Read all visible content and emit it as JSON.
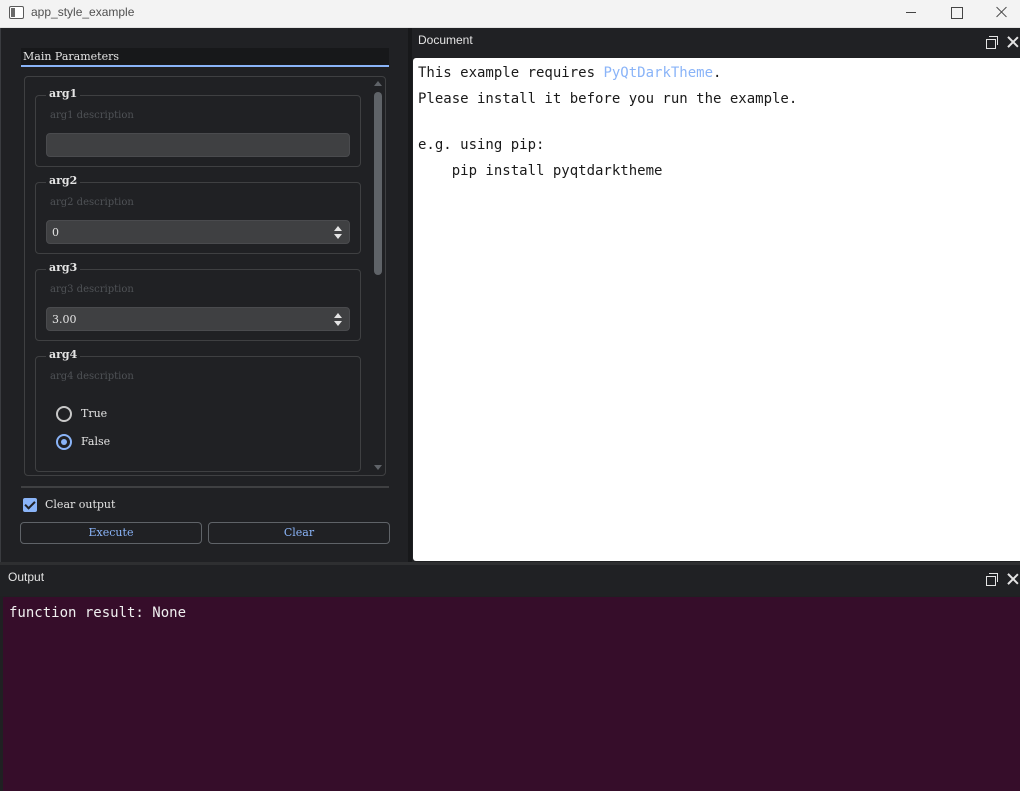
{
  "window": {
    "title": "app_style_example"
  },
  "left_panel": {
    "group_title": "Main Parameters",
    "args": [
      {
        "title": "arg1",
        "description": "arg1 description",
        "value": ""
      },
      {
        "title": "arg2",
        "description": "arg2 description",
        "value": "0"
      },
      {
        "title": "arg3",
        "description": "arg3 description",
        "value": "3.00"
      },
      {
        "title": "arg4",
        "description": "arg4 description",
        "options": [
          "True",
          "False"
        ],
        "selected": "False"
      }
    ],
    "clear_output_label": "Clear output",
    "clear_output_checked": true,
    "execute_label": "Execute",
    "clear_label": "Clear"
  },
  "document": {
    "title": "Document",
    "line1_prefix": "This example requires ",
    "line1_link": "PyQtDarkTheme",
    "line1_suffix": ".",
    "line2": "Please install it before you run the example.",
    "line3": "e.g. using pip:",
    "line4": "    pip install pyqtdarktheme"
  },
  "output": {
    "title": "Output",
    "text": "function result: None"
  },
  "colors": {
    "accent": "#8ab4f8",
    "panel_bg": "#202124",
    "output_bg": "#360d2a"
  }
}
